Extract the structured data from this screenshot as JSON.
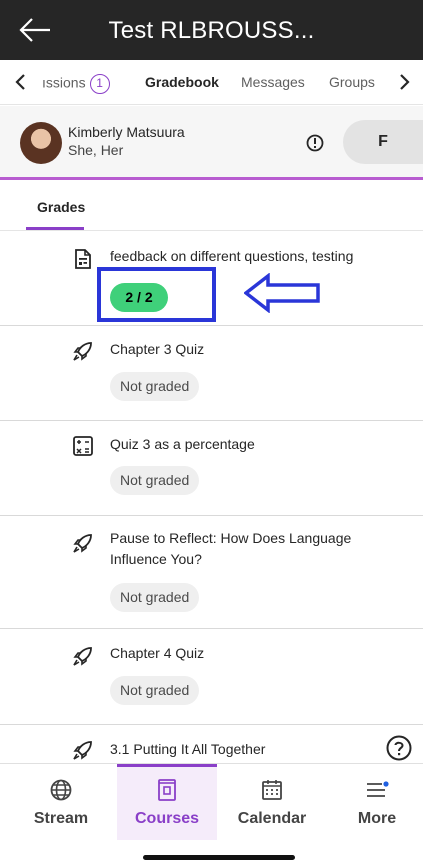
{
  "header": {
    "title": "Test RLBROUSS..."
  },
  "tabs": [
    {
      "label": "ıssions",
      "badge": "1"
    },
    {
      "label": "Gradebook"
    },
    {
      "label": "Messages"
    },
    {
      "label": "Groups"
    }
  ],
  "student": {
    "name": "Kimberly Matsuura",
    "pronouns": "She, Her",
    "overall_grade": "F"
  },
  "section": {
    "label": "Grades"
  },
  "items": [
    {
      "title": "feedback on different questions, testing",
      "grade": "2 / 2",
      "icon": "document-icon"
    },
    {
      "title": "Chapter 3 Quiz",
      "grade": "Not graded",
      "icon": "rocket-icon"
    },
    {
      "title": "Quiz 3 as a percentage",
      "grade": "Not graded",
      "icon": "calculator-icon"
    },
    {
      "title": "Pause to Reflect: How Does Language Influence You?",
      "grade": "Not graded",
      "icon": "rocket-icon"
    },
    {
      "title": "Chapter 4 Quiz",
      "grade": "Not graded",
      "icon": "rocket-icon"
    },
    {
      "title": "3.1 Putting It All Together",
      "icon": "rocket-icon"
    }
  ],
  "nav": {
    "stream": "Stream",
    "courses": "Courses",
    "calendar": "Calendar",
    "more": "More"
  },
  "colors": {
    "accent": "#8a3fc8",
    "grade_green": "#3fd07a",
    "annotation_blue": "#2a36d8"
  }
}
